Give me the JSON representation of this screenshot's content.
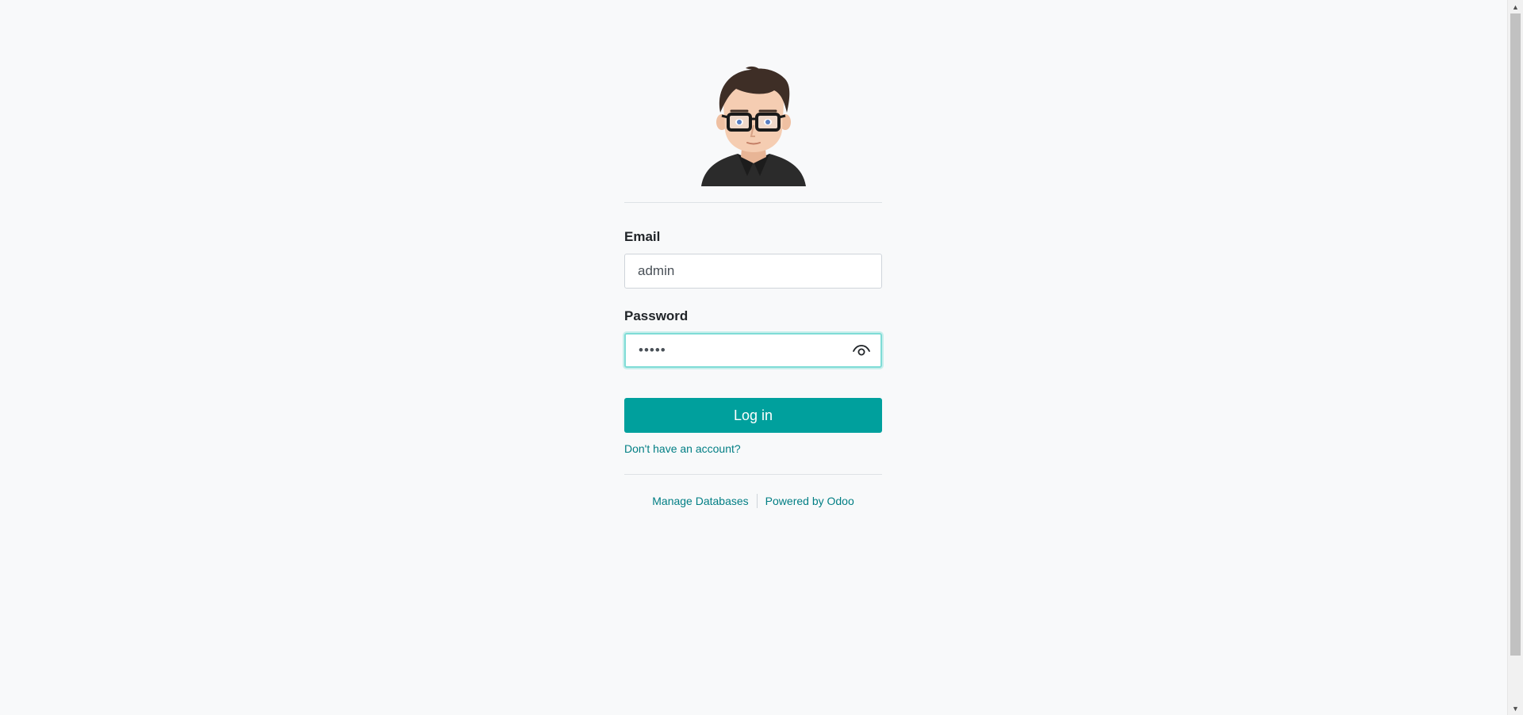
{
  "login": {
    "email_label": "Email",
    "email_value": "admin",
    "password_label": "Password",
    "password_value": "•••••",
    "submit_label": "Log in",
    "signup_link": "Don't have an account?"
  },
  "footer": {
    "manage_databases": "Manage Databases",
    "powered_by": "Powered by Odoo"
  },
  "icons": {
    "avatar": "user-avatar-image",
    "password_toggle": "eye-icon",
    "scroll_up": "chevron-up-icon",
    "scroll_down": "chevron-down-icon"
  },
  "colors": {
    "primary": "#00a09d",
    "link": "#017e84",
    "background": "#f8f9fa",
    "focus_border": "#7fdcd6"
  }
}
